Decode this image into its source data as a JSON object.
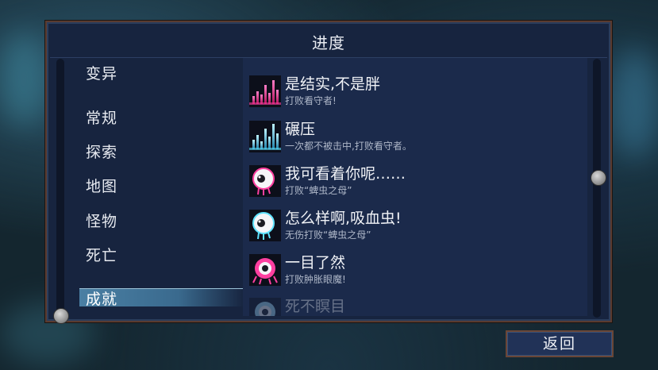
{
  "panel": {
    "title": "进度"
  },
  "categories": [
    {
      "label": "变异"
    },
    {
      "label": "常规"
    },
    {
      "label": "探索"
    },
    {
      "label": "地图"
    },
    {
      "label": "怪物"
    },
    {
      "label": "死亡"
    },
    {
      "label": "成就",
      "selected": true
    }
  ],
  "achievements": [
    {
      "title": "是结实,不是胖",
      "desc": "打败看守者!",
      "icon": "bars-magenta-icon"
    },
    {
      "title": "碾压",
      "desc": "一次都不被击中,打败看守者。",
      "icon": "bars-cyan-icon"
    },
    {
      "title": "我可看着你呢……",
      "desc": "打败“蜱虫之母”",
      "icon": "eyeball-magenta-icon"
    },
    {
      "title": "怎么样啊,吸血虫!",
      "desc": "无伤打败“蜱虫之母”",
      "icon": "eyeball-cyan-icon"
    },
    {
      "title": "一目了然",
      "desc": "打败肿胀眼魔!",
      "icon": "eye-monster-magenta-icon"
    },
    {
      "title": "死不瞑目",
      "desc": "",
      "icon": "eye-monster-faded-icon"
    }
  ],
  "footer": {
    "back_label": "返回"
  },
  "colors": {
    "accent_magenta": "#ff3fa0",
    "accent_cyan": "#5fe3ff",
    "panel_bg": "#17243f",
    "border": "#5a3b30"
  }
}
